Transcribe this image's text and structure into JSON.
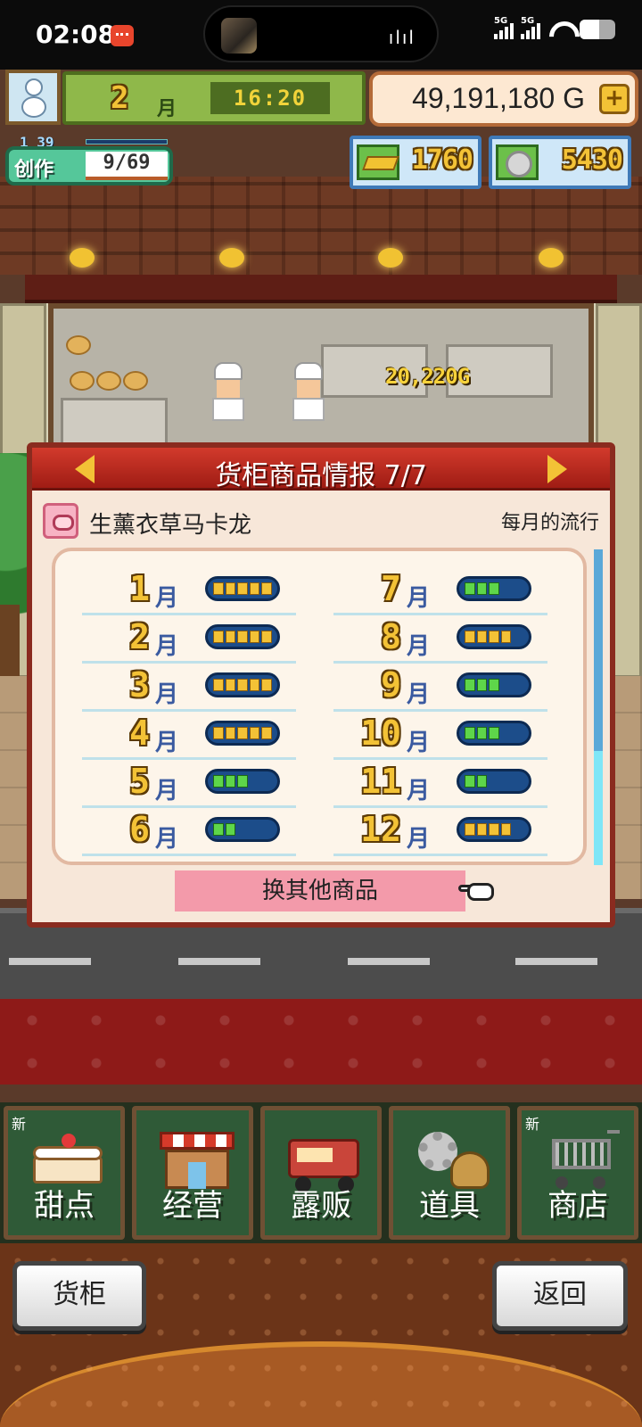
{
  "status_bar": {
    "time": "02:08",
    "network_1": "5G",
    "network_2": "5G"
  },
  "hud": {
    "month_number": "2",
    "month_unit": "月",
    "clock": "16:20",
    "gold": "49,191,180 G",
    "create": {
      "level_text": "1 39",
      "label": "创作",
      "value": "9/69"
    },
    "gold_bars": "1760",
    "coins": "5430"
  },
  "scene": {
    "shop_earnings": "20,220G"
  },
  "panel": {
    "title": "货柜商品情报 7/7",
    "item_name": "生薰衣草马卡龙",
    "trend_label": "每月的流行",
    "swap_button": "换其他商品",
    "months": [
      {
        "num": "1",
        "unit": "月",
        "level": 5,
        "color": "gold"
      },
      {
        "num": "2",
        "unit": "月",
        "level": 5,
        "color": "gold"
      },
      {
        "num": "3",
        "unit": "月",
        "level": 5,
        "color": "gold"
      },
      {
        "num": "4",
        "unit": "月",
        "level": 5,
        "color": "gold"
      },
      {
        "num": "5",
        "unit": "月",
        "level": 3,
        "color": "green"
      },
      {
        "num": "6",
        "unit": "月",
        "level": 2,
        "color": "green"
      },
      {
        "num": "7",
        "unit": "月",
        "level": 3,
        "color": "green"
      },
      {
        "num": "8",
        "unit": "月",
        "level": 4,
        "color": "gold"
      },
      {
        "num": "9",
        "unit": "月",
        "level": 3,
        "color": "green"
      },
      {
        "num": "10",
        "unit": "月",
        "level": 3,
        "color": "green"
      },
      {
        "num": "11",
        "unit": "月",
        "level": 2,
        "color": "green"
      },
      {
        "num": "12",
        "unit": "月",
        "level": 4,
        "color": "gold"
      }
    ]
  },
  "menu": {
    "items": [
      {
        "label": "甜点",
        "badge": "新"
      },
      {
        "label": "经营",
        "badge": ""
      },
      {
        "label": "露贩",
        "badge": ""
      },
      {
        "label": "道具",
        "badge": ""
      },
      {
        "label": "商店",
        "badge": "新"
      }
    ]
  },
  "footer": {
    "left_button": "货柜",
    "right_button": "返回"
  },
  "colors": {
    "panel_header": "#b5271c",
    "bar_gold": "#f3c236",
    "bar_green": "#5ed64a",
    "swap_button": "#f39aaa"
  }
}
